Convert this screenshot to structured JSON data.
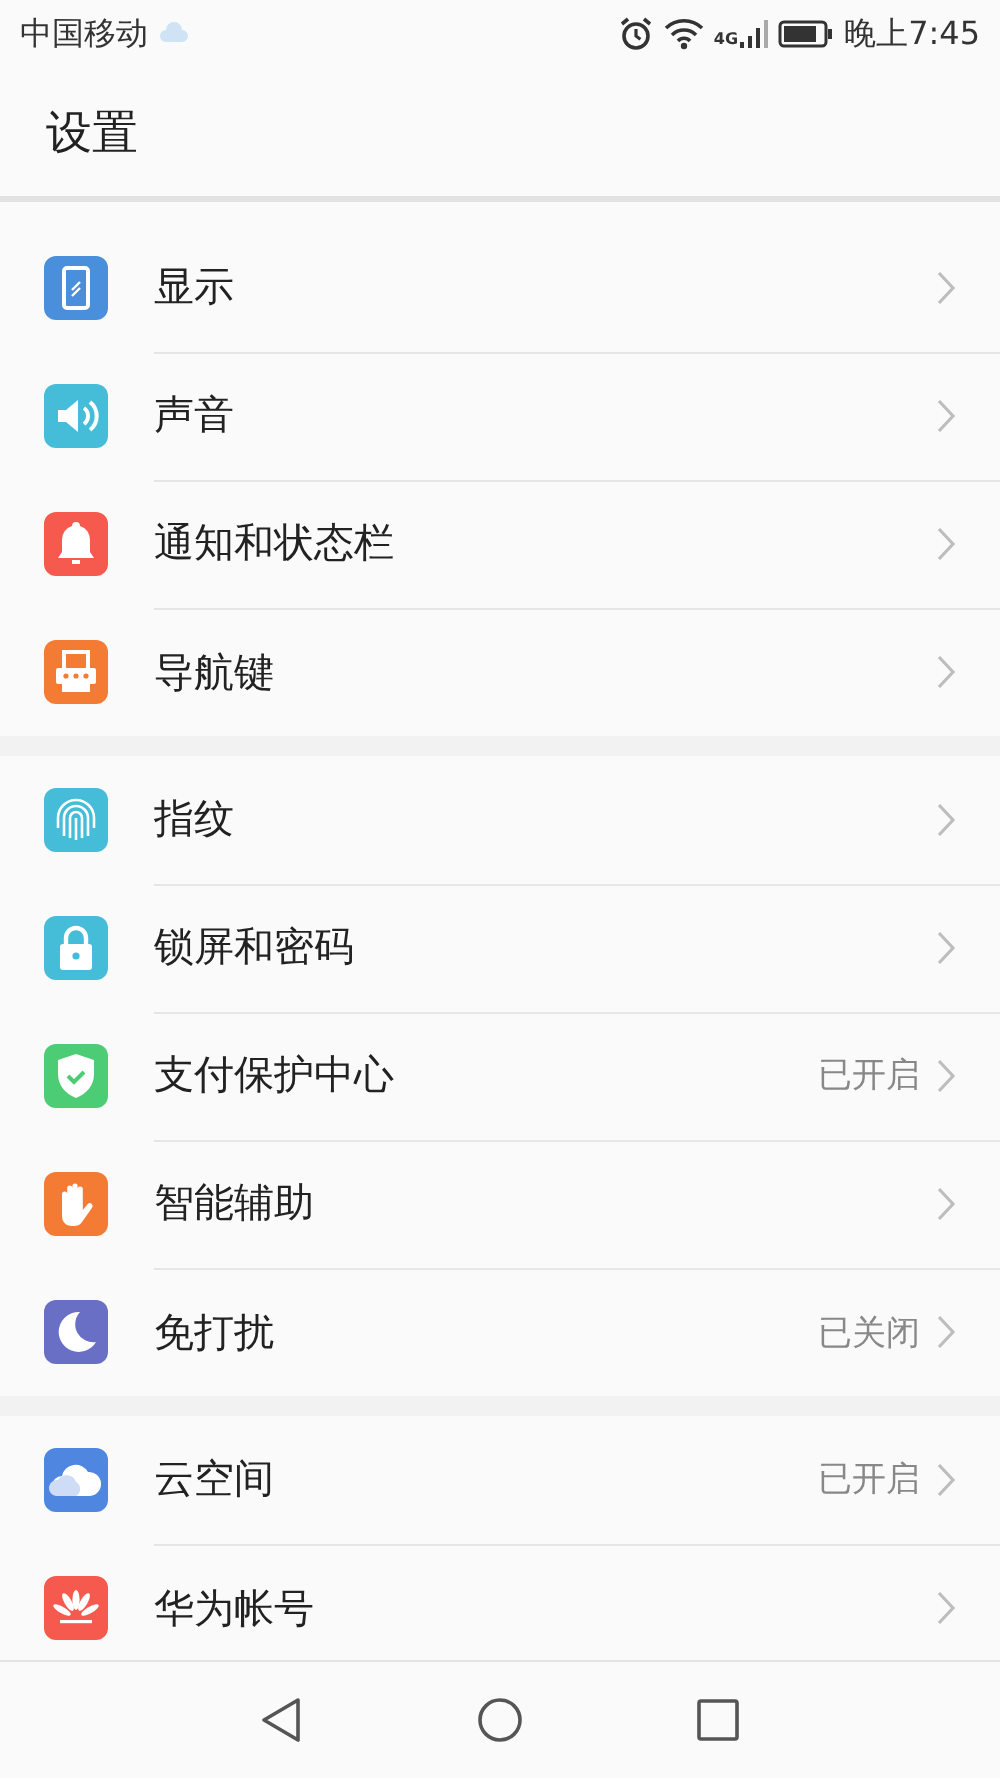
{
  "status_bar": {
    "carrier": "中国移动",
    "network": "4G",
    "time": "晚上7:45"
  },
  "header": {
    "title": "设置"
  },
  "groups": [
    {
      "items": [
        {
          "label": "显示",
          "color": "#4a8fdc"
        },
        {
          "label": "声音",
          "color": "#45bcd8"
        },
        {
          "label": "通知和状态栏",
          "color": "#f65a4f"
        },
        {
          "label": "导航键",
          "color": "#f37b34"
        }
      ]
    },
    {
      "items": [
        {
          "label": "指纹",
          "color": "#45bcd8"
        },
        {
          "label": "锁屏和密码",
          "color": "#45bcd8"
        },
        {
          "label": "支付保护中心",
          "color": "#4ccc74",
          "status": "已开启"
        },
        {
          "label": "智能辅助",
          "color": "#f37b34"
        },
        {
          "label": "免打扰",
          "color": "#6a6fc6",
          "status": "已关闭"
        }
      ]
    },
    {
      "items": [
        {
          "label": "云空间",
          "color": "#4f86e0",
          "status": "已开启"
        },
        {
          "label": "华为帐号",
          "color": "#f65a4f"
        }
      ]
    }
  ]
}
